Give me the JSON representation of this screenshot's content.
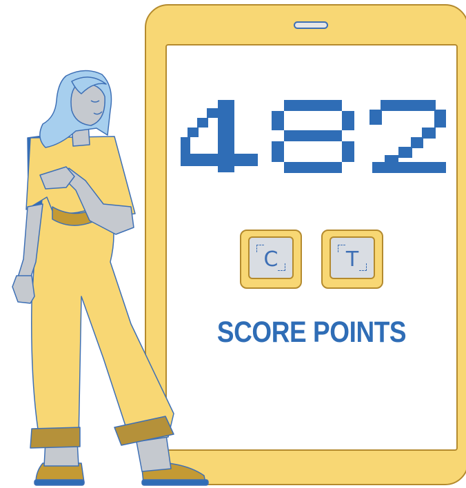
{
  "score": {
    "value": "482",
    "caption": "SCORE POINTS"
  },
  "keys": [
    {
      "letter": "C"
    },
    {
      "letter": "T"
    }
  ],
  "colors": {
    "accent_blue": "#2f6db6",
    "device_yellow": "#f8d774",
    "outline_gold": "#b48a2d",
    "skin_gray": "#c5c9cf",
    "hair_blue": "#a7cfee"
  }
}
